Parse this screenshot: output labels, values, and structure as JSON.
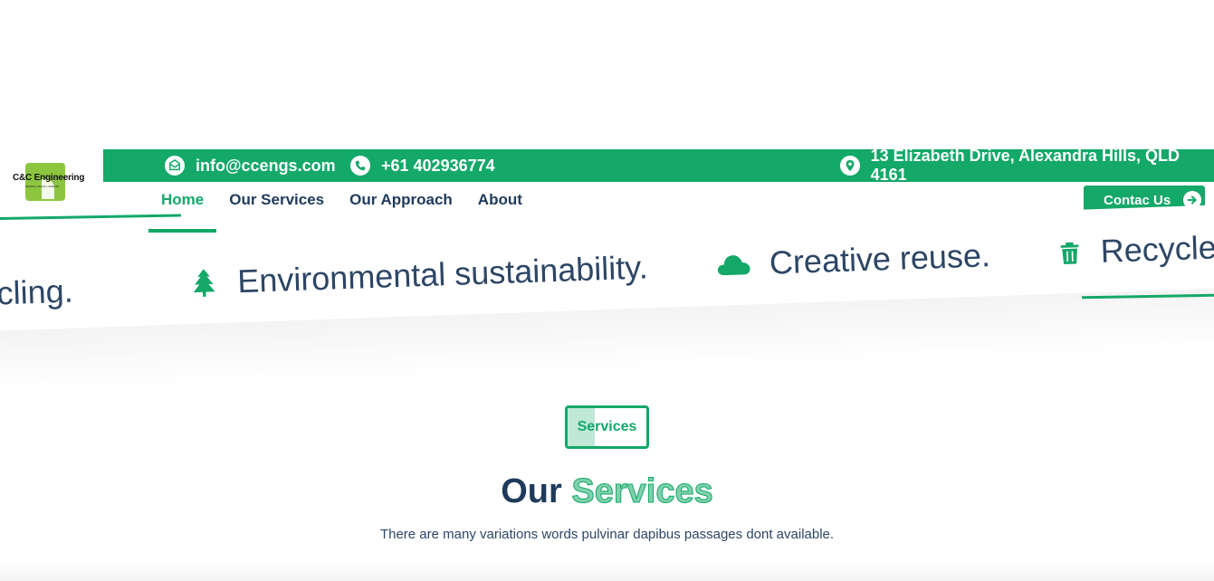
{
  "topbar": {
    "email": "info@ccengs.com",
    "phone": "+61 402936774",
    "address": "13 Elizabeth Drive, Alexandra Hills, QLD 4161"
  },
  "logo": {
    "name": "C&C Engineering",
    "tagline": "DESIGN | BUILD | CREATE"
  },
  "nav": {
    "items": [
      "Home",
      "Our Services",
      "Our Approach",
      "About"
    ],
    "active": "Home"
  },
  "contact_button": {
    "label": "Contac Us"
  },
  "marquee": {
    "items": [
      {
        "text": "cycling.",
        "icon": ""
      },
      {
        "text": "Environmental sustainability.",
        "icon": "tree-icon"
      },
      {
        "text": "Creative reuse.",
        "icon": "cloud-icon"
      },
      {
        "text": "Recycled",
        "icon": "trash-icon"
      }
    ]
  },
  "services": {
    "tag": "Services",
    "heading_prefix": "Our",
    "heading_accent": "Services",
    "subtitle": "There are many variations words pulvinar dapibus passages dont available."
  },
  "colors": {
    "brand_green": "#14a869",
    "navy": "#1f3a5a",
    "logo_green": "#8cc63f"
  }
}
